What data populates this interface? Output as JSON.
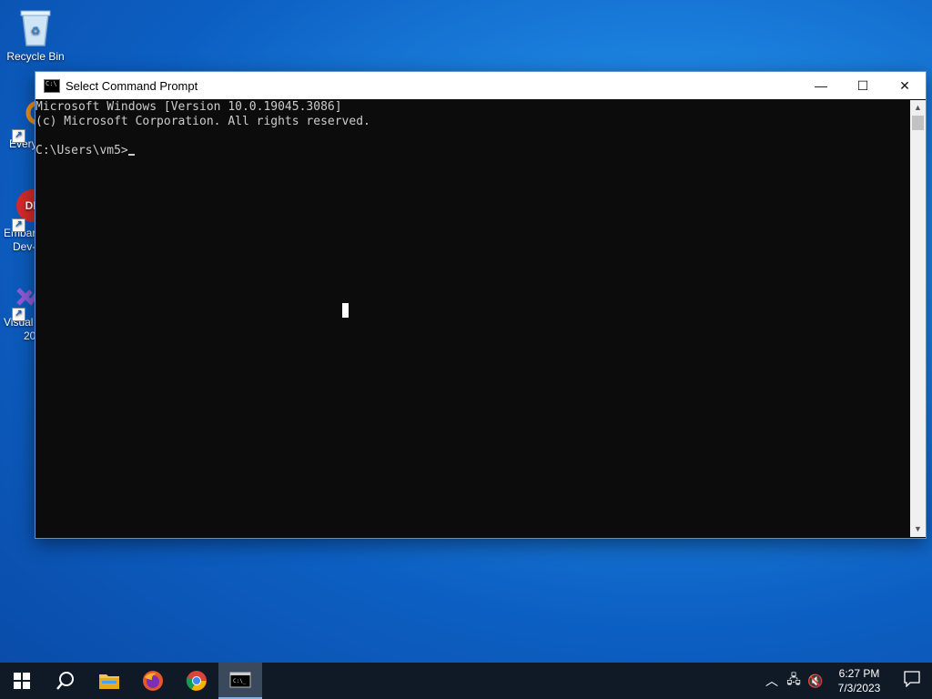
{
  "desktop": {
    "icons": [
      {
        "label": "Recycle Bin"
      },
      {
        "label": "Every"
      },
      {
        "label": "Embar"
      },
      {
        "label": "Dev-"
      },
      {
        "label": "Visual"
      },
      {
        "label": "20"
      }
    ]
  },
  "window": {
    "title": "Select Command Prompt",
    "controls": {
      "minimize": "—",
      "maximize": "☐",
      "close": "✕"
    }
  },
  "console": {
    "lines": [
      "Microsoft Windows [Version 10.0.19045.3086]",
      "(c) Microsoft Corporation. All rights reserved.",
      "",
      "C:\\Users\\vm5>"
    ]
  },
  "taskbar": {
    "clock_time": "6:27 PM",
    "clock_date": "7/3/2023"
  }
}
